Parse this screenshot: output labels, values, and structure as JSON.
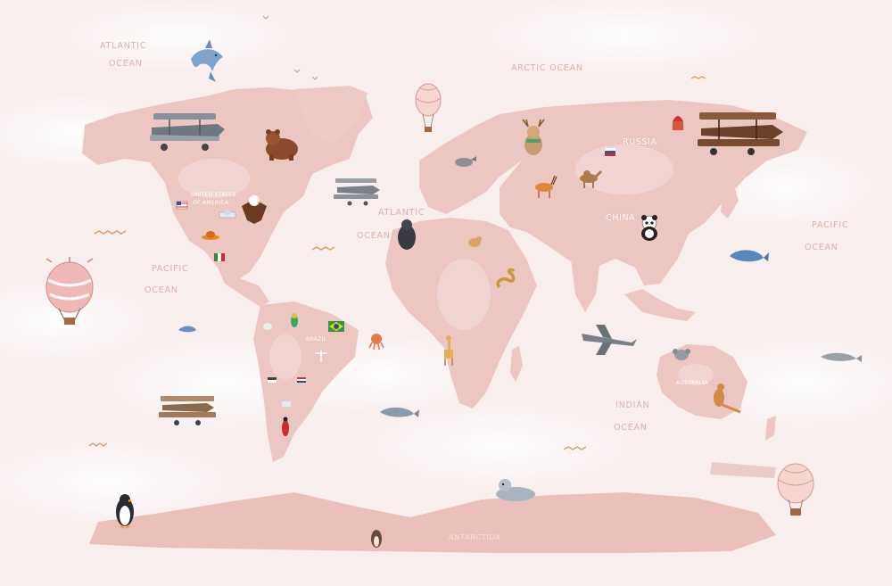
{
  "map": {
    "oceans": {
      "atlantic_nw_1": "ATLANTIC",
      "atlantic_nw_2": "OCEAN",
      "arctic": "ARCTIC OCEAN",
      "atlantic_mid_1": "ATLANTIC",
      "atlantic_mid_2": "OCEAN",
      "pacific_east_1": "PACIFIC",
      "pacific_east_2": "OCEAN",
      "pacific_west_1": "PACIFIC",
      "pacific_west_2": "OCEAN",
      "indian_1": "INDIAN",
      "indian_2": "OCEAN"
    },
    "countries": {
      "russia": "RUSSIA",
      "china": "CHINA",
      "usa_1": "UNITED STATES",
      "usa_2": "OF AMERICA",
      "brazil": "BRAZIL",
      "australia": "AUSTRALIA",
      "antarctida": "ANTARCTIDA"
    },
    "colors": {
      "background": "#f8eeee",
      "land": "#ecc6c1",
      "land_light": "#f1d4d0",
      "label": "#d9a8a3",
      "cloud": "#ffffff"
    },
    "icons": [
      "dolphin-icon",
      "biplane-icon",
      "bear-icon",
      "eagle-icon",
      "hot-air-balloon-icon",
      "reindeer-icon",
      "camel-icon",
      "antelope-icon",
      "panda-icon",
      "whale-icon",
      "gorilla-icon",
      "giraffe-icon",
      "snake-icon",
      "kangaroo-icon",
      "koala-icon",
      "penguin-icon",
      "seal-icon",
      "parrot-icon",
      "octopus-icon",
      "fox-icon"
    ]
  }
}
